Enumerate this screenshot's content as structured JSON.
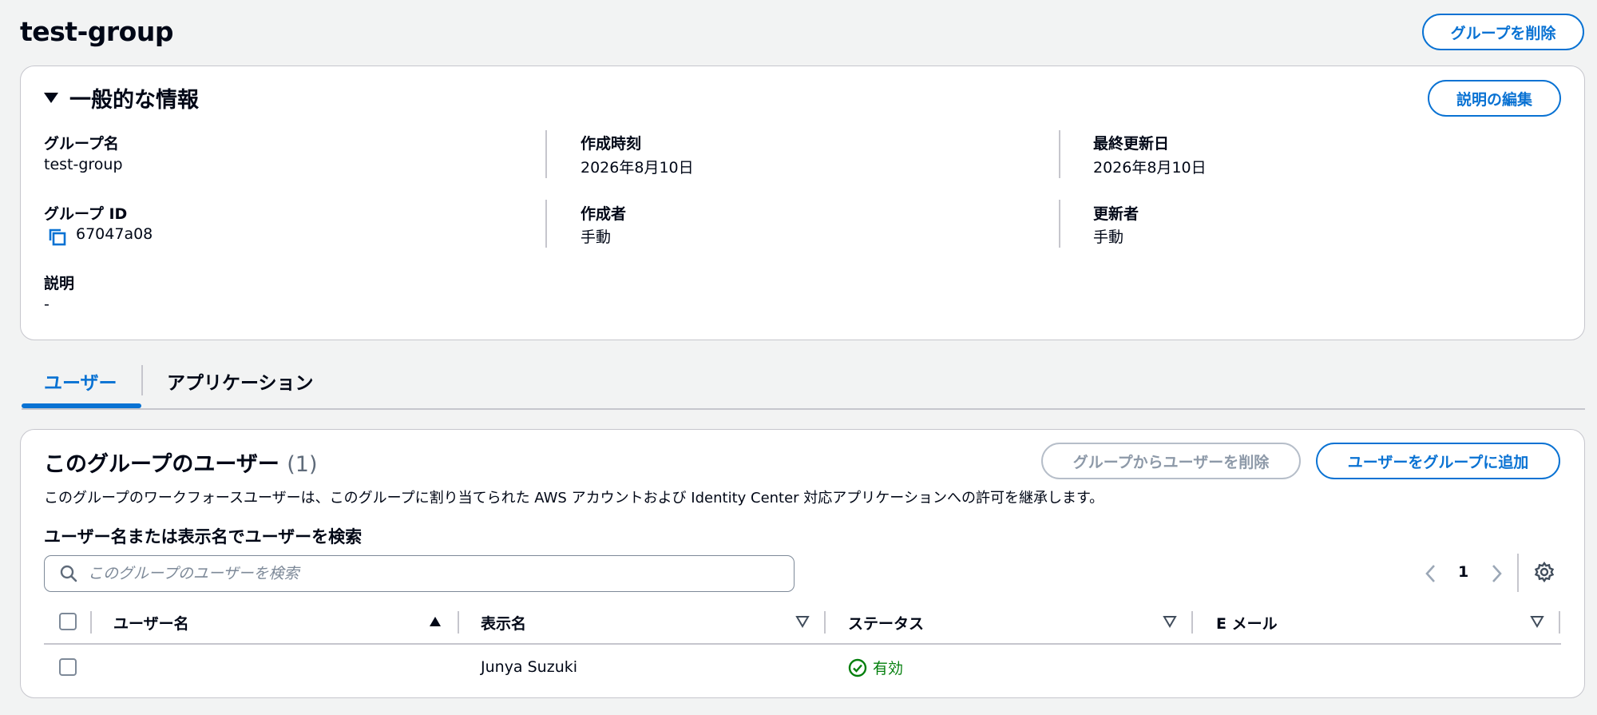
{
  "page": {
    "title": "test-group",
    "delete_group_label": "グループを削除"
  },
  "general": {
    "title": "一般的な情報",
    "edit_description_label": "説明の編集",
    "fields": {
      "group_name_label": "グループ名",
      "group_name_value": "test-group",
      "created_at_label": "作成時刻",
      "created_at_value": "2026年8月10日",
      "updated_at_label": "最終更新日",
      "updated_at_value": "2026年8月10日",
      "group_id_label": "グループ ID",
      "group_id_value": "67047a08",
      "created_by_label": "作成者",
      "created_by_value": "手動",
      "updated_by_label": "更新者",
      "updated_by_value": "手動",
      "description_label": "説明",
      "description_value": "-"
    }
  },
  "tabs": [
    {
      "label": "ユーザー",
      "active": true
    },
    {
      "label": "アプリケーション",
      "active": false
    }
  ],
  "users_panel": {
    "title": "このグループのユーザー",
    "count": "(1)",
    "remove_button_label": "グループからユーザーを削除",
    "add_button_label": "ユーザーをグループに追加",
    "description": "このグループのワークフォースユーザーは、このグループに割り当てられた AWS アカウントおよび Identity Center 対応アプリケーションへの許可を継承します。",
    "search_label": "ユーザー名または表示名でユーザーを検索",
    "search_placeholder": "このグループのユーザーを検索",
    "pagination": {
      "current_page": "1"
    },
    "columns": [
      "ユーザー名",
      "表示名",
      "ステータス",
      "E メール"
    ],
    "rows": [
      {
        "username": "",
        "display_name": "Junya Suzuki",
        "status": "有効",
        "email": ""
      }
    ]
  },
  "colors": {
    "accent": "#0972d3",
    "success": "#037f0c",
    "background": "#f2f3f3"
  },
  "icons": [
    "triangle-down-icon",
    "copy-icon",
    "search-icon",
    "chevron-left-icon",
    "chevron-right-icon",
    "gear-icon",
    "sort-ascending-icon",
    "sort-descending-icon",
    "status-success-icon"
  ]
}
